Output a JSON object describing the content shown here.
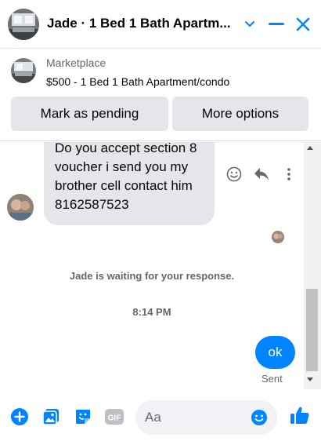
{
  "header": {
    "title": "Jade · 1 Bed 1 Bath Apartm...",
    "chevron_icon": "chevron-down-icon",
    "minimize_icon": "minimize-icon",
    "close_icon": "close-icon"
  },
  "marketplace": {
    "label": "Marketplace",
    "listing": "$500 - 1 Bed 1 Bath Apartment/condo",
    "buttons": {
      "pending": "Mark as pending",
      "more": "More options"
    }
  },
  "thread": {
    "incoming_message": "Do you accept section 8 voucher i send you my brother cell contact him 8162587523",
    "actions": {
      "react_icon": "smiley-icon",
      "reply_icon": "reply-icon",
      "more_icon": "more-dots-icon"
    },
    "waiting_text": "Jade is waiting for your response.",
    "timestamp": "8:14 PM",
    "outgoing_message": "ok",
    "status": "Sent"
  },
  "composer": {
    "placeholder": "Aa",
    "icons": [
      "plus-icon",
      "photo-icon",
      "sticker-icon",
      "gif-icon",
      "emoji-icon",
      "thumbs-up-icon"
    ]
  },
  "colors": {
    "accent": "#0084ff",
    "bubble_in": "#e4e6eb",
    "secondary_text": "#65676b"
  }
}
